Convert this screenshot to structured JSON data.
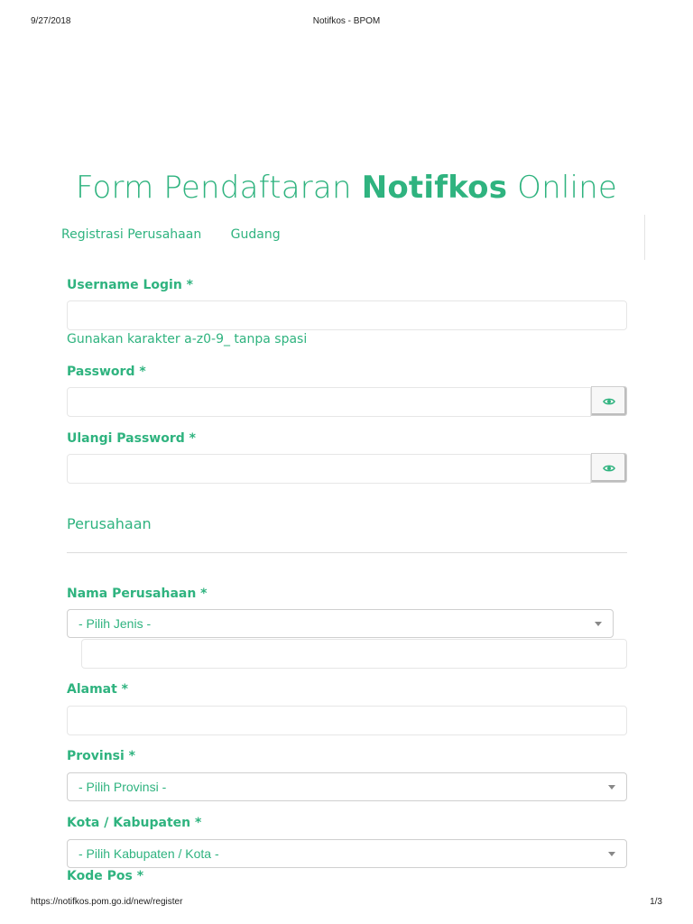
{
  "print_header": {
    "date": "9/27/2018",
    "page_title": "Notifkos - BPOM"
  },
  "print_footer": {
    "url": "https://notifkos.pom.go.id/new/register",
    "page_number": "1/3"
  },
  "form": {
    "title_prefix": "Form Pendaftaran ",
    "title_bold": "Notifkos",
    "title_suffix": " Online"
  },
  "tabs": [
    {
      "label": "Registrasi Perusahaan"
    },
    {
      "label": "Gudang"
    }
  ],
  "fields": {
    "username": {
      "label": "Username Login *",
      "value": "",
      "help": "Gunakan karakter a-z0-9_ tanpa spasi"
    },
    "password": {
      "label": "Password *",
      "value": ""
    },
    "password_repeat": {
      "label": "Ulangi Password *",
      "value": ""
    },
    "nama_perusahaan": {
      "label": "Nama Perusahaan *",
      "select_value": "- Pilih Jenis -",
      "value": ""
    },
    "alamat": {
      "label": "Alamat *",
      "value": ""
    },
    "provinsi": {
      "label": "Provinsi *",
      "select_value": "- Pilih Provinsi -"
    },
    "kota": {
      "label": "Kota / Kabupaten *",
      "select_value": "- Pilih Kabupaten / Kota -"
    },
    "kode_pos": {
      "label": "Kode Pos *"
    }
  },
  "section": {
    "title": "Perusahaan"
  },
  "icons": {
    "password_toggle": "eye-icon",
    "select_arrow": "caret-down-icon"
  },
  "colors": {
    "accent": "#2fb37f",
    "border": "#e6e6e6"
  }
}
